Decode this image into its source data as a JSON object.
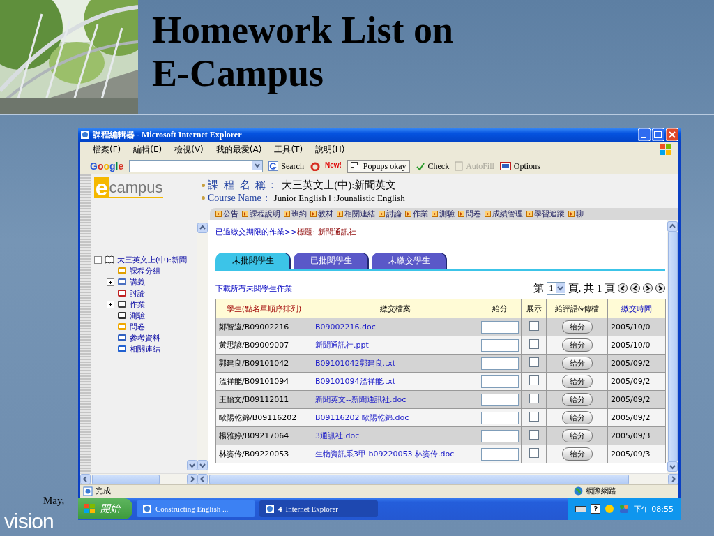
{
  "slide": {
    "title_lines": [
      "Homework List on",
      "E-Campus"
    ],
    "date": "May,",
    "brand": "vision"
  },
  "window": {
    "title": "課程編輯器 - Microsoft Internet Explorer"
  },
  "menu": [
    "檔案(F)",
    "編輯(E)",
    "檢視(V)",
    "我的最愛(A)",
    "工具(T)",
    "說明(H)"
  ],
  "google_toolbar": {
    "logo": "Google",
    "search": "Search",
    "new_badge": "New!",
    "popups": "Popups okay",
    "check": "Check",
    "autofill": {
      "label": "AutoFill",
      "disabled": true
    },
    "options": "Options"
  },
  "sidebar": {
    "logo": [
      "e",
      "campus"
    ],
    "tree": {
      "label": "大三英文上(中):新聞",
      "expanded": true,
      "children": [
        {
          "label": "課程分組"
        },
        {
          "label": "講義",
          "expanded": false
        },
        {
          "label": "討論"
        },
        {
          "label": "作業",
          "expanded": false
        },
        {
          "label": "測驗"
        },
        {
          "label": "問卷"
        },
        {
          "label": "參考資料"
        },
        {
          "label": "相關連結"
        }
      ]
    }
  },
  "course": {
    "name_label": "課 程 名 稱：",
    "name": "大三英文上(中):新聞英文",
    "en_label": "Course Name：",
    "en_name": "Junior English Ⅰ :Jounalistic English"
  },
  "nav": [
    "公告",
    "課程說明",
    "班約",
    "教材",
    "相關連結",
    "討論",
    "作業",
    "測驗",
    "問卷",
    "成績管理",
    "學習追蹤",
    "聊"
  ],
  "breadcrumb": {
    "path": "已過繳交期限的作業>>",
    "title": "標題: 新聞通訊社"
  },
  "tabs": [
    {
      "label": "未批閱學生",
      "selected": true
    },
    {
      "label": "已批閱學生",
      "selected": false
    },
    {
      "label": "未繳交學生",
      "selected": false
    }
  ],
  "download_link": "下載所有未閱學生作業",
  "pager": {
    "prefix": "第",
    "page": "1",
    "suffix": "頁, 共 1 頁"
  },
  "table": {
    "columns": [
      "學生(點名單順序排列)",
      "繳交檔案",
      "給分",
      "展示",
      "給評語&傳檔",
      "繳交時間"
    ],
    "rows": [
      {
        "student": "鄭智遠/B09002216",
        "file": "B09002216.doc",
        "shown": false,
        "action": "給分",
        "time": "2005/10/0"
      },
      {
        "student": "黃思諺/B09009007",
        "file": "新聞通訊社.ppt",
        "shown": false,
        "action": "給分",
        "time": "2005/10/0"
      },
      {
        "student": "郭建良/B09101042",
        "file": "B09101042郭建良.txt",
        "shown": false,
        "action": "給分",
        "time": "2005/09/2"
      },
      {
        "student": "溫祥能/B09101094",
        "file": "B09101094溫祥能.txt",
        "shown": false,
        "action": "給分",
        "time": "2005/09/2"
      },
      {
        "student": "王怡文/B09112011",
        "file": "新聞英文--新聞通訊社.doc",
        "shown": false,
        "action": "給分",
        "time": "2005/09/2"
      },
      {
        "student": "歐陽乾錦/B09116202",
        "file": "B09116202 歐陽乾錦.doc",
        "shown": false,
        "action": "給分",
        "time": "2005/09/2"
      },
      {
        "student": "楊雅婷/B09217064",
        "file": "3通訊社.doc",
        "shown": false,
        "action": "給分",
        "time": "2005/09/3"
      },
      {
        "student": "林姿伶/B09220053",
        "file": "生物資訊系3甲 b09220053 林姿伶.doc",
        "shown": false,
        "action": "給分",
        "time": "2005/09/3"
      }
    ]
  },
  "status_bar": {
    "text": "完成",
    "zone": "網際網路"
  },
  "taskbar": {
    "start": "開始",
    "tasks": [
      {
        "label": "Constructing English ...",
        "selected": false
      },
      {
        "count": "4",
        "label": "Internet Explorer",
        "selected": true
      }
    ],
    "clock": "下午 08:55"
  }
}
